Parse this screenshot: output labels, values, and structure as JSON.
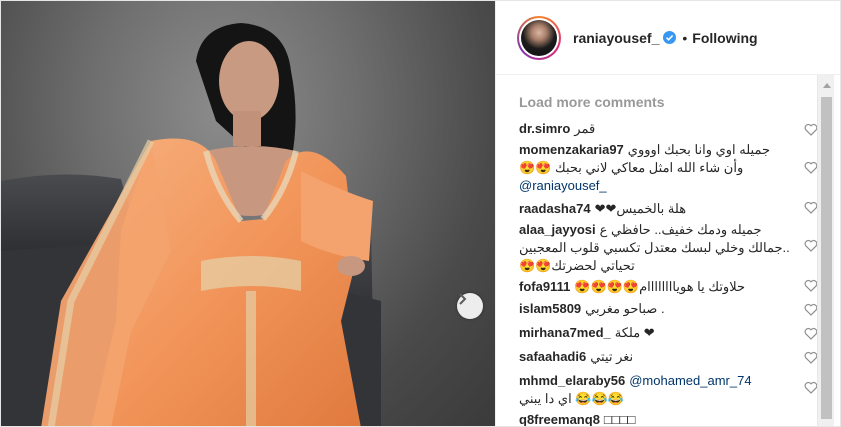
{
  "post": {
    "username": "raniayousef_",
    "separator": "•",
    "follow_status": "Following",
    "load_more": "Load more comments"
  },
  "comments": [
    {
      "user": "dr.simro",
      "text": "قمر"
    },
    {
      "user": "momenzakaria97",
      "text": "جميله اوي وانا بحبك اوووي",
      "line2": "😍😍 وأن شاء الله امثل معاكي لاني بحبك",
      "mention": "@raniayousef_"
    },
    {
      "user": "raadasha74",
      "text": "❤❤هلة بالخميس"
    },
    {
      "user": "alaa_jayyosi",
      "text": "جميله ودمك خفيف.. حافظي ع",
      "line2": "جمالك وخلي لبسك معتدل تكسبي قلوب المعجبين..",
      "line3": "😍😍تحياتي لحضرتك"
    },
    {
      "user": "fofa9111",
      "text": "😍😍😍😍حلاوتك يا هوياااااااام"
    },
    {
      "user": "islam5809",
      "text": "صباحو مغربي ."
    },
    {
      "user": "mirhana7med_",
      "text": "ملكة ❤"
    },
    {
      "user": "safaahadi6",
      "text": "نغر تيتي"
    },
    {
      "user": "mhmd_elaraby56",
      "mention": "@mohamed_amr_74",
      "line2": "اي دا يبني 😂😂😂"
    },
    {
      "user": "q8freemanq8",
      "text": "□□□□"
    }
  ],
  "colors": {
    "dress": "#f2955a",
    "verified": "#3897f0",
    "mention": "#003569",
    "muted": "#999999"
  },
  "icons": {
    "next": "chevron-right-icon",
    "like": "heart-outline-icon",
    "verified": "verified-badge-icon"
  }
}
